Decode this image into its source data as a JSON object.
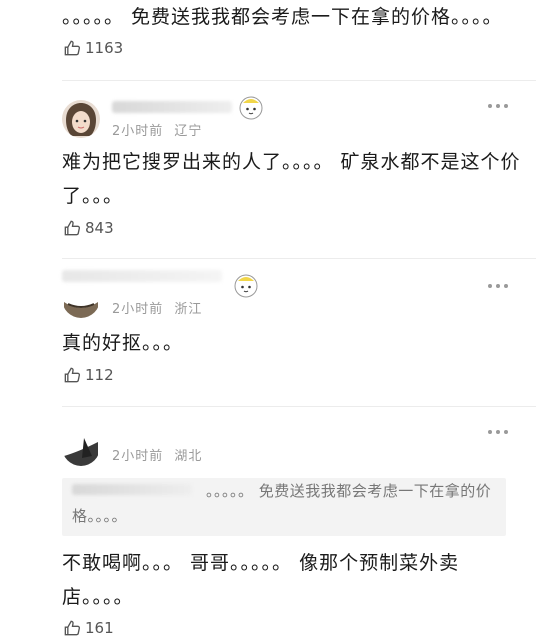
{
  "comments": [
    {
      "text": "。。。。。 免费送我我都会考虑一下在拿的价格。。。。",
      "likes": "1163"
    },
    {
      "time": "2小时前",
      "location": "辽宁",
      "text": "难为把它搜罗出来的人了。。。。 矿泉水都不是这个价了。。。",
      "likes": "843"
    },
    {
      "time": "2小时前",
      "location": "浙江",
      "text": "真的好抠。。。",
      "likes": "112"
    },
    {
      "time": "2小时前",
      "location": "湖北",
      "quote": "。。。。。 免费送我我都会考虑一下在拿的价格。。。。",
      "text": "不敢喝啊。。。 哥哥。。。。。 像那个预制菜外卖店。。。。",
      "likes": "161"
    }
  ],
  "colors": {
    "text": "#1b1b1b",
    "meta": "#9a9a9a",
    "quote_bg": "#f3f3f3"
  },
  "icons": [
    "thumb-up-icon",
    "more-icon",
    "fan-badge-icon"
  ]
}
